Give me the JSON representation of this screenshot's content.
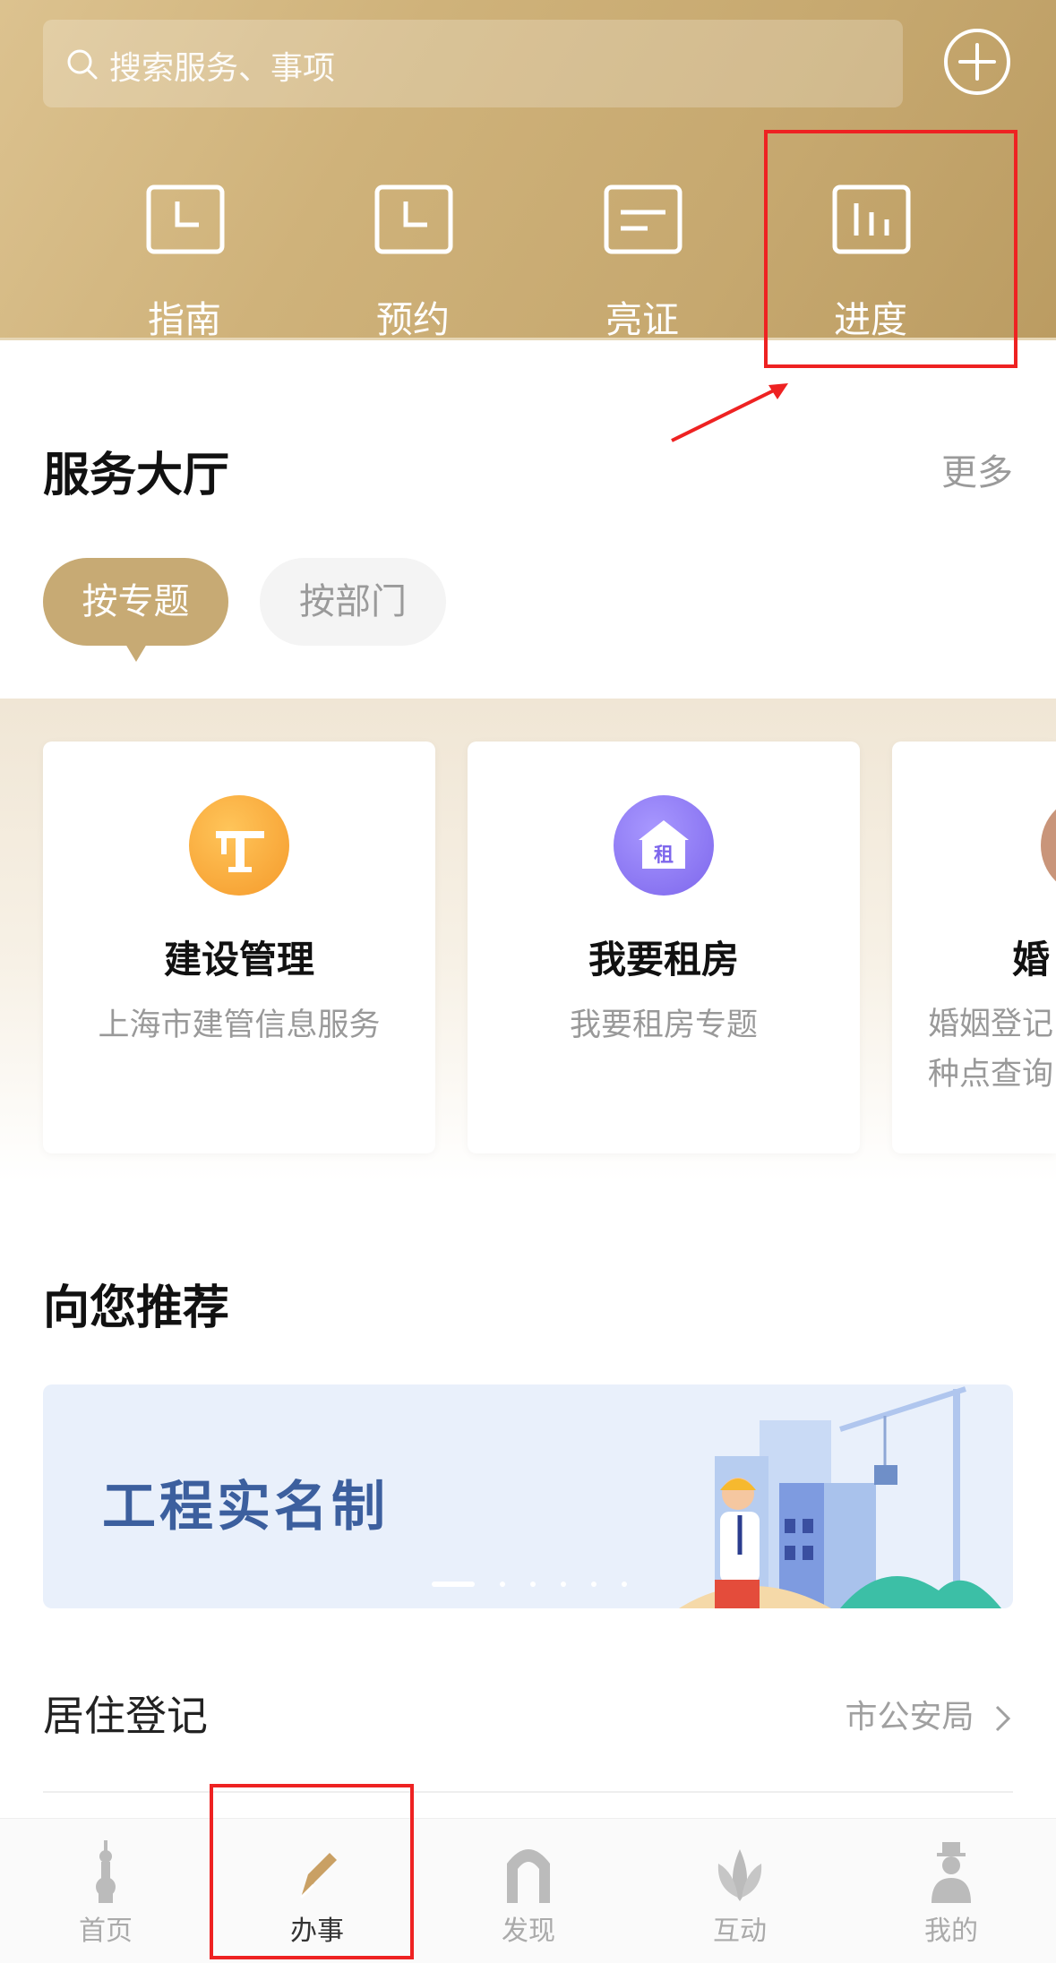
{
  "search": {
    "placeholder": "搜索服务、事项"
  },
  "quick_actions": [
    {
      "label": "指南",
      "icon": "clock-icon"
    },
    {
      "label": "预约",
      "icon": "clock-icon"
    },
    {
      "label": "亮证",
      "icon": "id-card-icon"
    },
    {
      "label": "进度",
      "icon": "bar-chart-icon"
    }
  ],
  "service_hall": {
    "title": "服务大厅",
    "more": "更多",
    "tabs": [
      "按专题",
      "按部门"
    ]
  },
  "cards": [
    {
      "title": "建设管理",
      "subtitle": "上海市建管信息服务",
      "icon": "crane-icon",
      "color": "#f8a93a"
    },
    {
      "title": "我要租房",
      "subtitle": "我要租房专题",
      "icon": "rent-house-icon",
      "color": "#8a78f0"
    },
    {
      "title": "婚",
      "subtitle_line1": "婚姻登记",
      "subtitle_line2": "种点查询",
      "icon": "marriage-icon",
      "color": "#c9957a"
    }
  ],
  "recommend": {
    "title": "向您推荐",
    "banner_text": "工程实名制"
  },
  "list_row": {
    "title": "居住登记",
    "right": "市公安局"
  },
  "tabbar": [
    {
      "label": "首页",
      "icon": "tower-icon"
    },
    {
      "label": "办事",
      "icon": "pen-icon"
    },
    {
      "label": "发现",
      "icon": "arch-icon"
    },
    {
      "label": "互动",
      "icon": "magnolia-icon"
    },
    {
      "label": "我的",
      "icon": "person-icon"
    }
  ],
  "colors": {
    "header": "#c9ad74",
    "accent": "#c7aa74",
    "highlight": "#e22222"
  }
}
